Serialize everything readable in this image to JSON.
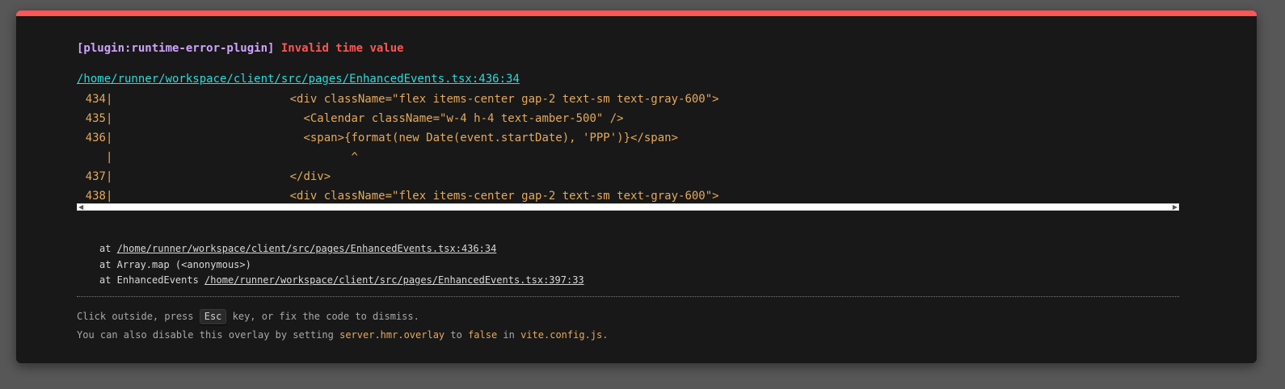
{
  "error": {
    "plugin": "[plugin:runtime-error-plugin]",
    "message": "Invalid time value"
  },
  "file": "/home/runner/workspace/client/src/pages/EnhancedEvents.tsx:436:34",
  "code_frame": [
    {
      "num": "434",
      "sep": "|",
      "text": "                          <div className=\"flex items-center gap-2 text-sm text-gray-600\">"
    },
    {
      "num": "435",
      "sep": "|",
      "text": "                            <Calendar className=\"w-4 h-4 text-amber-500\" />"
    },
    {
      "num": "436",
      "sep": "|",
      "text": "                            <span>{format(new Date(event.startDate), 'PPP')}</span>"
    },
    {
      "num": "",
      "sep": "|",
      "text": "                                   ^"
    },
    {
      "num": "437",
      "sep": "|",
      "text": "                          </div>"
    },
    {
      "num": "438",
      "sep": "|",
      "text": "                          <div className=\"flex items-center gap-2 text-sm text-gray-600\">"
    }
  ],
  "stack": [
    {
      "prefix": "at ",
      "link": "/home/runner/workspace/client/src/pages/EnhancedEvents.tsx:436:34"
    },
    {
      "prefix": "at Array.map (<anonymous>)",
      "link": ""
    },
    {
      "prefix": "at EnhancedEvents ",
      "link": "/home/runner/workspace/client/src/pages/EnhancedEvents.tsx:397:33"
    }
  ],
  "tip": {
    "line1_a": "Click outside, press ",
    "key": "Esc",
    "line1_b": " key, or fix the code to dismiss.",
    "line2_a": "You can also disable this overlay by setting ",
    "setting": "server.hmr.overlay",
    "line2_b": " to ",
    "value": "false",
    "line2_c": " in ",
    "config_file": "vite.config.js",
    "line2_d": "."
  },
  "colors": {
    "accent_red": "#ff5555",
    "plugin_purple": "#cfa4ff",
    "link_cyan": "#2dd9da",
    "code_orange": "#e5a95b"
  }
}
